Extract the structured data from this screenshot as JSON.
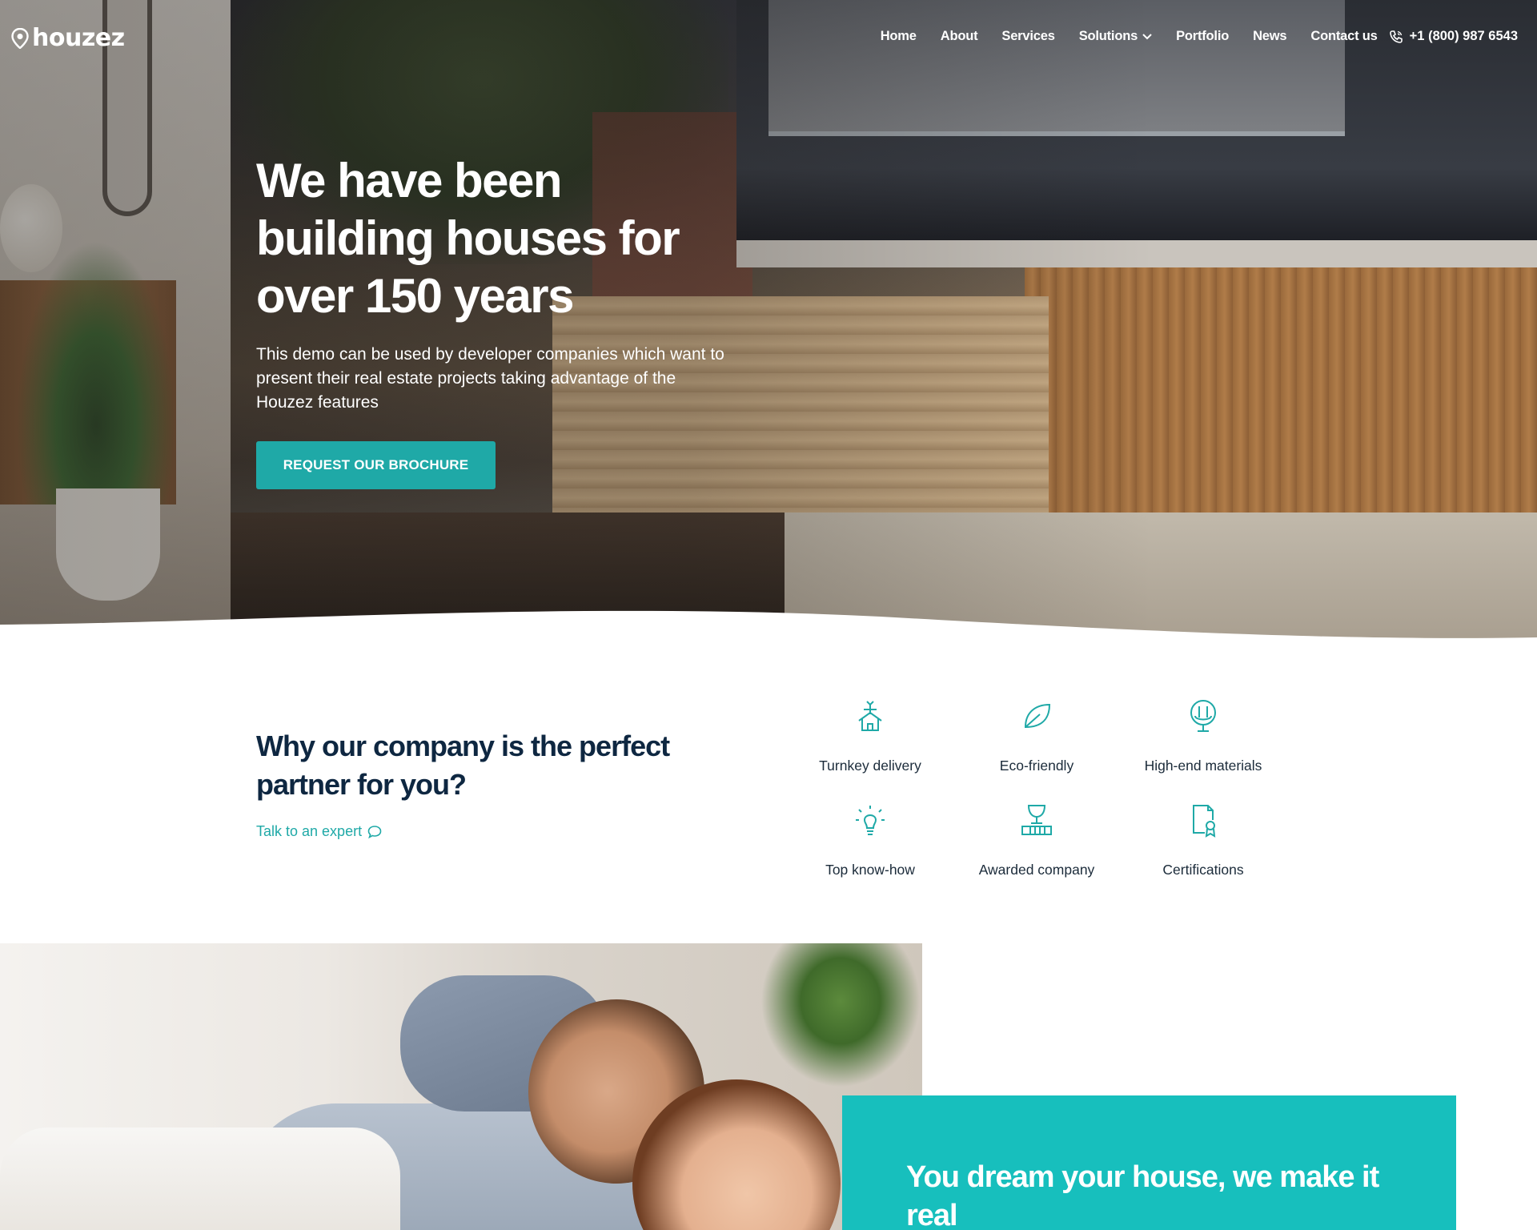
{
  "brand": {
    "name": "houzez",
    "icon": "location-pin-icon"
  },
  "nav": {
    "items": [
      "Home",
      "About",
      "Services",
      "Solutions",
      "Portfolio",
      "News",
      "Contact us"
    ],
    "dropdown_item": "Solutions",
    "phone": "+1 (800) 987 6543",
    "phone_icon": "phone-icon"
  },
  "hero": {
    "title": "We have been building houses for over 150 years",
    "subtitle": "This demo can be used by developer companies which want to present their real estate projects taking advantage of the Houzez features",
    "cta": "REQUEST OUR BROCHURE"
  },
  "why": {
    "title": "Why our company is the perfect partner for you?",
    "link": "Talk to an expert",
    "link_icon": "chat-bubble-icon"
  },
  "features": [
    {
      "label": "Turnkey delivery",
      "icon": "crane-house-icon"
    },
    {
      "label": "Eco-friendly",
      "icon": "leaf-icon"
    },
    {
      "label": "High-end materials",
      "icon": "chair-icon"
    },
    {
      "label": "Top know-how",
      "icon": "lightbulb-icon"
    },
    {
      "label": "Awarded company",
      "icon": "trophy-icon"
    },
    {
      "label": "Certifications",
      "icon": "certificate-icon"
    }
  ],
  "dream": {
    "title": "You dream your house, we make it real"
  },
  "colors": {
    "accent": "#1fa9a7",
    "teal_box": "#17bfbd",
    "heading": "#0e2741",
    "white": "#ffffff"
  }
}
